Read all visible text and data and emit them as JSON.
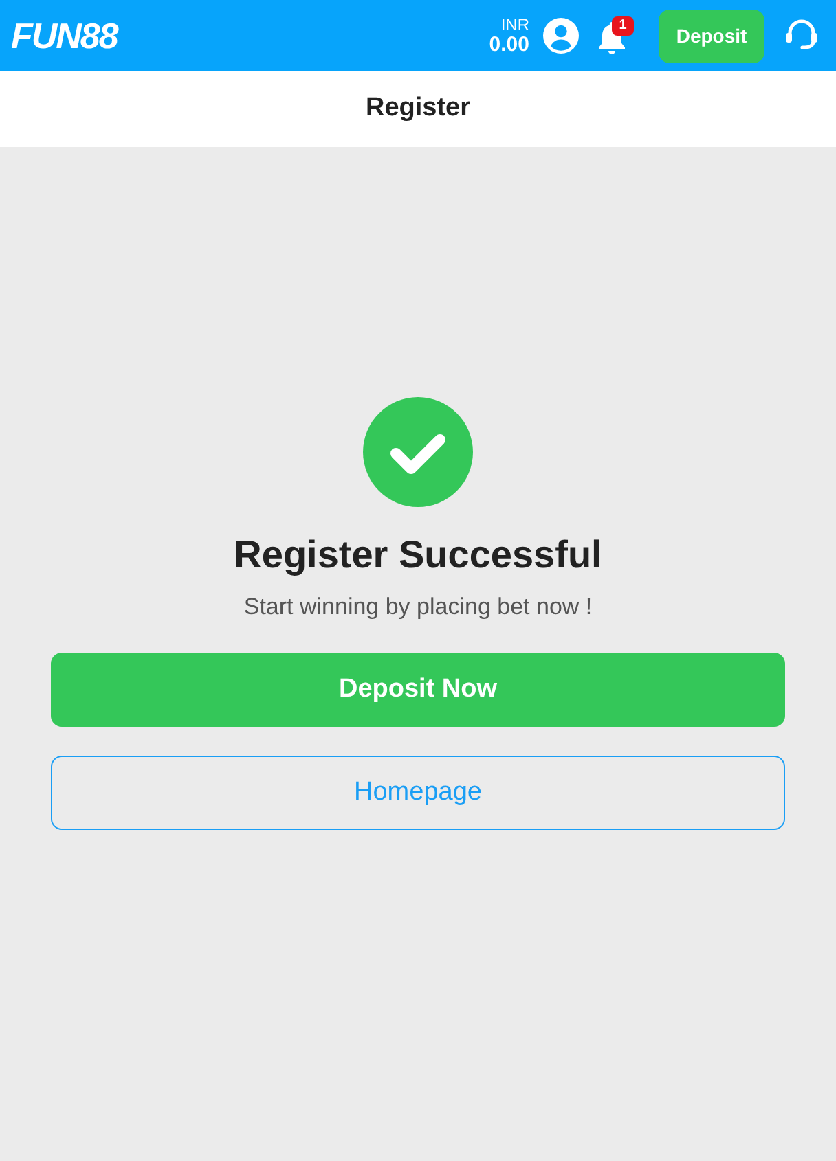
{
  "header": {
    "logo": "FUN88",
    "balance": {
      "currency": "INR",
      "amount": "0.00"
    },
    "notifications": {
      "badge": "1"
    },
    "deposit_button": "Deposit"
  },
  "title_bar": {
    "title": "Register"
  },
  "result": {
    "title": "Register Successful",
    "subtitle": "Start winning by placing bet now !",
    "buttons": [
      {
        "label": "Deposit Now",
        "kind": "primary"
      },
      {
        "label": "Homepage",
        "kind": "outline"
      }
    ]
  }
}
